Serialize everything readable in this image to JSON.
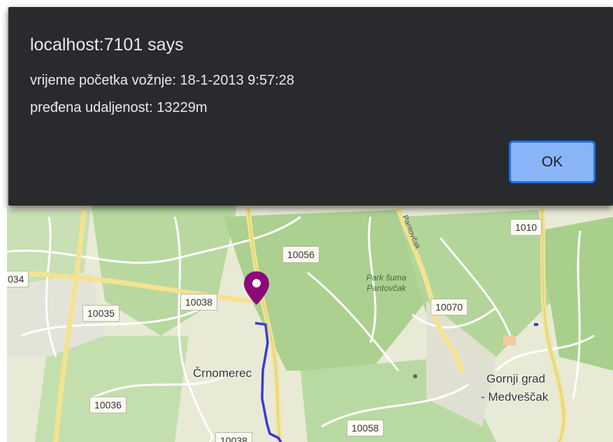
{
  "dialog": {
    "title": "localhost:7101 says",
    "start_time_line": "vrijeme početka vožnje: 18-1-2013 9:57:28",
    "distance_line": "pređena udaljenost: 13229m",
    "ok_label": "OK"
  },
  "map": {
    "road_labels": [
      "1010",
      "10056",
      "034",
      "10038",
      "10070",
      "10035",
      "10036",
      "10058",
      "10038"
    ],
    "places": {
      "crnomerec": "Črnomerec",
      "gornji_grad_1": "Gornji grad",
      "gornji_grad_2": "- Medveščak"
    },
    "park": {
      "line1": "Park šuma",
      "line2": "Pantovčak"
    },
    "street": "Pantovčak",
    "colors": {
      "route": "#3a3ad8",
      "marker": "#8a0a7a",
      "forest": "#acd08f",
      "main_road": "#f5e79a"
    }
  }
}
